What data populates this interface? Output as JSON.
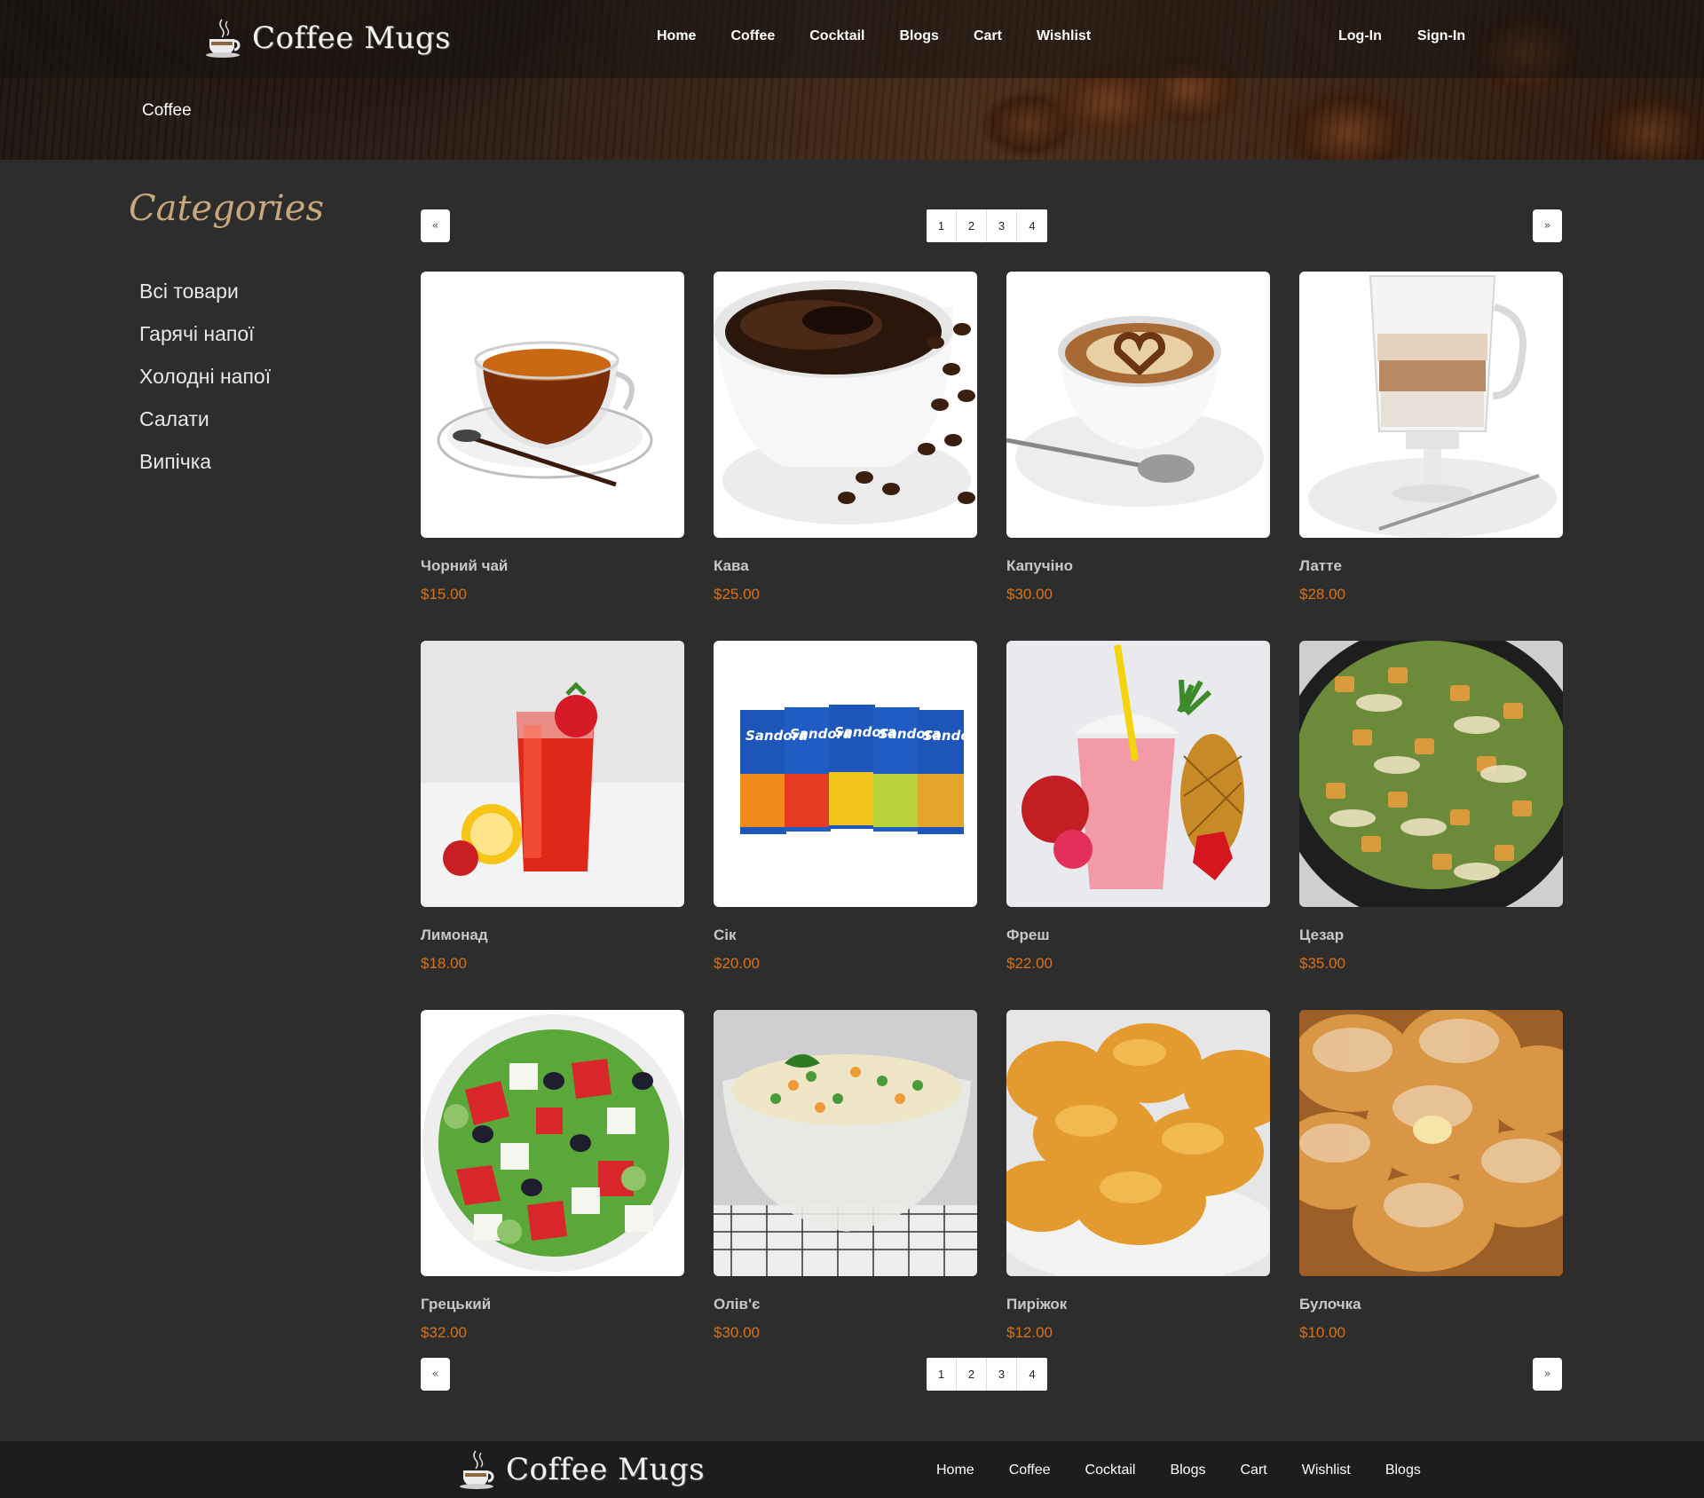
{
  "site": {
    "logo_text": "Coffee Mugs"
  },
  "nav": {
    "home": "Home",
    "coffee": "Coffee",
    "cocktail": "Cocktail",
    "blogs": "Blogs",
    "cart": "Cart",
    "wishlist": "Wishlist"
  },
  "auth": {
    "login": "Log-In",
    "signin": "Sign-In"
  },
  "breadcrumb": "Coffee",
  "sidebar": {
    "title": "Categories",
    "items": [
      "Всі товари",
      "Гарячі напої",
      "Холодні напої",
      "Салати",
      "Випічка"
    ]
  },
  "pagination": {
    "prev": "«",
    "next": "»",
    "pages": [
      "1",
      "2",
      "3",
      "4"
    ]
  },
  "products": [
    {
      "name": "Чорний чай",
      "price": "$15.00"
    },
    {
      "name": "Кава",
      "price": "$25.00"
    },
    {
      "name": "Капучіно",
      "price": "$30.00"
    },
    {
      "name": "Латте",
      "price": "$28.00"
    },
    {
      "name": "Лимонад",
      "price": "$18.00"
    },
    {
      "name": "Сік",
      "price": "$20.00"
    },
    {
      "name": "Фреш",
      "price": "$22.00"
    },
    {
      "name": "Цезар",
      "price": "$35.00"
    },
    {
      "name": "Грецький",
      "price": "$32.00"
    },
    {
      "name": "Олів'є",
      "price": "$30.00"
    },
    {
      "name": "Пиріжок",
      "price": "$12.00"
    },
    {
      "name": "Булочка",
      "price": "$10.00"
    }
  ],
  "product_images": [
    "black-tea",
    "coffee-cup",
    "cappuccino",
    "latte",
    "lemonade",
    "juice-packs",
    "smoothie",
    "caesar-salad",
    "greek-salad",
    "olivier-salad",
    "pies",
    "buns"
  ],
  "juice_brand": "Sandora",
  "footer": {
    "logo_text": "Coffee Mugs",
    "links": [
      "Home",
      "Coffee",
      "Cocktail",
      "Blogs",
      "Cart",
      "Wishlist",
      "Blogs"
    ]
  },
  "colors": {
    "page_bg": "#2d2d2d",
    "price": "#d4741a",
    "categories_title": "#c9a77c",
    "footer_bg": "#1d1d1d"
  }
}
